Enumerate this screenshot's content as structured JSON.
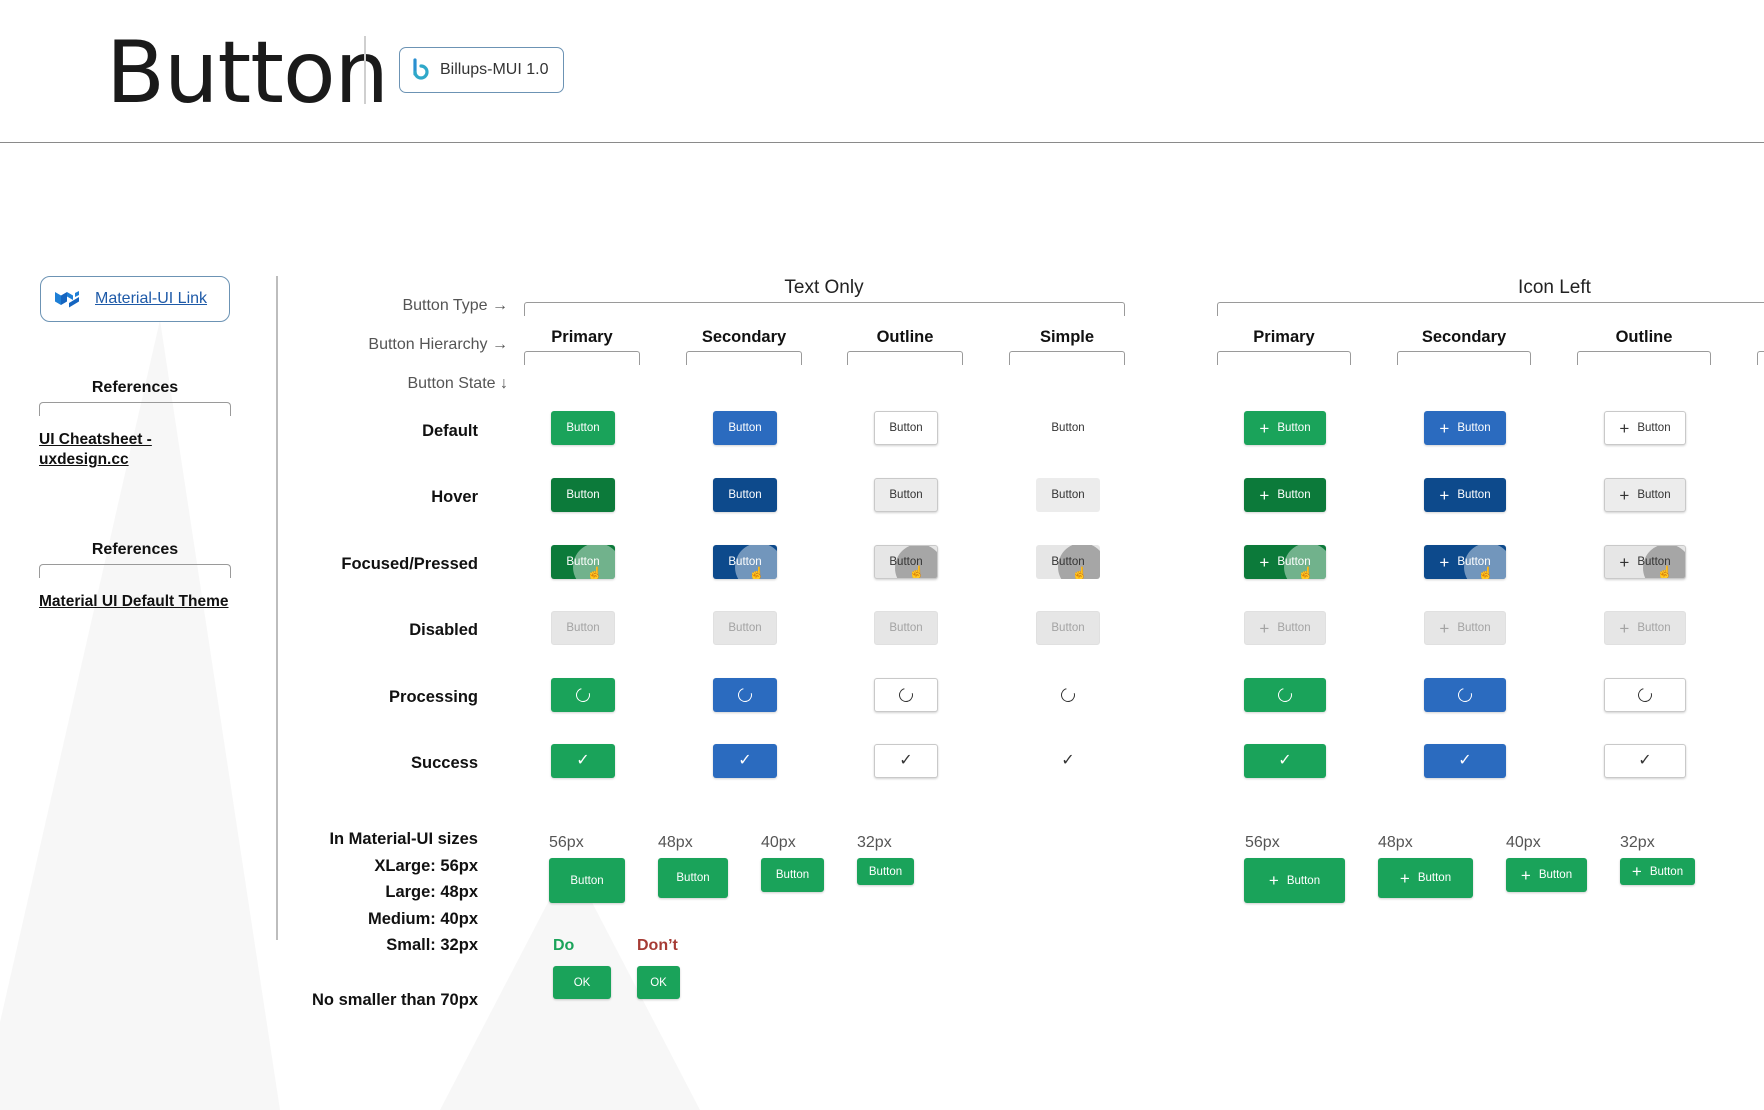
{
  "header": {
    "title": "Button",
    "badge_label": "Billups-MUI 1.0",
    "badge_icon": "billups-logo-icon"
  },
  "sidebar": {
    "mui_link": {
      "label": "Material-UI Link",
      "icon": "material-ui-logo-icon"
    },
    "reference_sections": [
      {
        "heading": "References",
        "link": "UI Cheatsheet - uxdesign.cc"
      },
      {
        "heading": "References",
        "link": "Material UI Default Theme"
      }
    ]
  },
  "meta_labels": {
    "button_type": "Button Type →",
    "button_hierarchy": "Button Hierarchy →",
    "button_state": "Button State ↓"
  },
  "groups": [
    {
      "title": "Text Only",
      "columns": [
        "Primary",
        "Secondary",
        "Outline",
        "Simple"
      ]
    },
    {
      "title": "Icon Left",
      "columns": [
        "Primary",
        "Secondary",
        "Outline"
      ]
    }
  ],
  "states": [
    "Default",
    "Hover",
    "Focused/Pressed",
    "Disabled",
    "Processing",
    "Success"
  ],
  "button_label": "Button",
  "colors": {
    "primary": "#1aa35a",
    "primary_hover": "#0c7a3a",
    "secondary": "#2b6bbf",
    "secondary_hover": "#0d4a8c",
    "disabled_bg": "#e6e6e6",
    "disabled_text": "#a3a3a3",
    "do": "#1aa35a",
    "dont": "#a63b34"
  },
  "sizes": {
    "labels": [
      "In Material-UI sizes",
      "XLarge: 56px",
      "Large: 48px",
      "Medium: 40px",
      "Small: 32px"
    ],
    "columns": [
      "56px",
      "48px",
      "40px",
      "32px"
    ],
    "button_label": "Button"
  },
  "do_dont": {
    "do_label": "Do",
    "dont_label": "Don’t",
    "button_label": "OK",
    "rule": "No smaller than 70px"
  }
}
